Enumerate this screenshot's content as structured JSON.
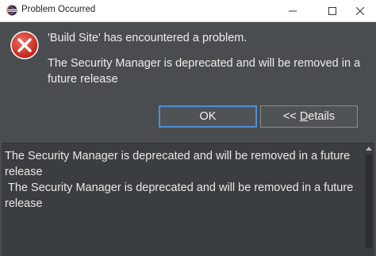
{
  "window": {
    "title": "Problem Occurred",
    "controls": {
      "minimize_icon": "minimize-icon",
      "maximize_icon": "maximize-icon",
      "close_icon": "close-icon"
    }
  },
  "message": {
    "icon": "error-icon",
    "title": "'Build Site' has encountered a problem.",
    "body": "The Security Manager is deprecated and will be removed in a future release"
  },
  "buttons": {
    "ok_label": "OK",
    "details_prefix": "<< ",
    "details_underlined": "D",
    "details_rest": "etails"
  },
  "details": {
    "line1": "The Security Manager is deprecated and will be removed in a future release",
    "line2": " The Security Manager is deprecated and will be removed in a future release"
  },
  "colors": {
    "dialog_bg": "#4a4d4f",
    "text": "#ededed",
    "accent_border": "#4f8fd6",
    "error_red": "#d9342b"
  }
}
